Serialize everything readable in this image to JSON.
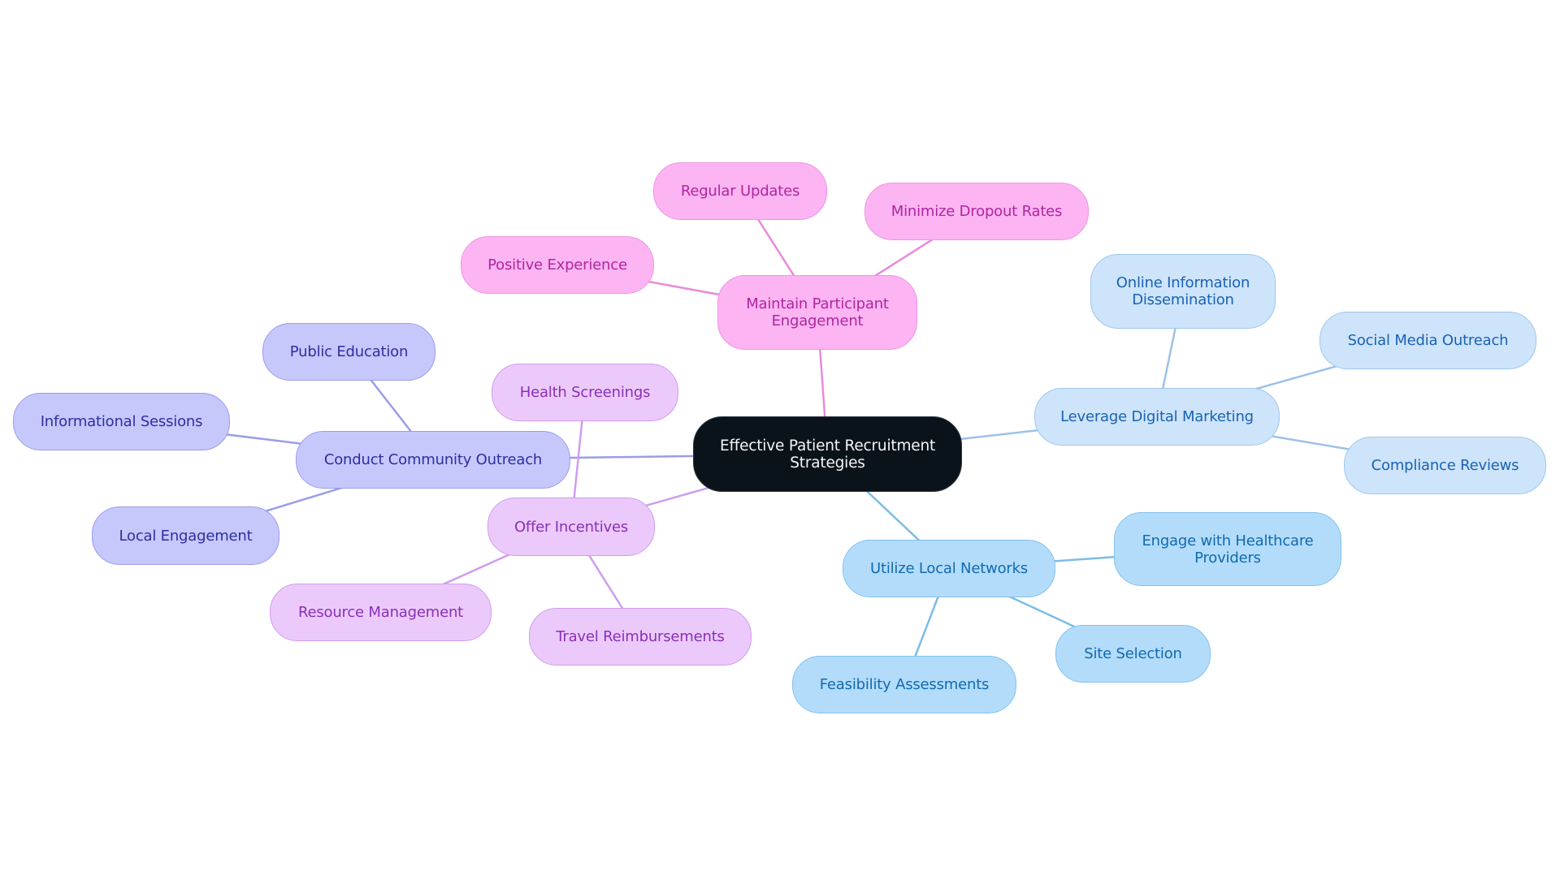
{
  "diagram": {
    "type": "mindmap",
    "root": {
      "id": "root",
      "label": "Effective Patient Recruitment Strategies"
    },
    "branches": [
      {
        "id": "engagement",
        "label": "Maintain Participant Engagement",
        "color_theme": "pink",
        "edge_color": "#e98ad9",
        "children": [
          {
            "id": "regular-updates",
            "label": "Regular Updates"
          },
          {
            "id": "minimize-dropout",
            "label": "Minimize Dropout Rates"
          },
          {
            "id": "positive-experience",
            "label": "Positive Experience"
          }
        ]
      },
      {
        "id": "digital",
        "label": "Leverage Digital Marketing",
        "color_theme": "blue1",
        "edge_color": "#9cc2e8",
        "children": [
          {
            "id": "online-info",
            "label": "Online Information Dissemination"
          },
          {
            "id": "social-media",
            "label": "Social Media Outreach"
          },
          {
            "id": "compliance",
            "label": "Compliance Reviews"
          }
        ]
      },
      {
        "id": "local-networks",
        "label": "Utilize Local Networks",
        "color_theme": "blue2",
        "edge_color": "#7bbde6",
        "children": [
          {
            "id": "healthcare-providers",
            "label": "Engage with Healthcare Providers"
          },
          {
            "id": "site-selection",
            "label": "Site Selection"
          },
          {
            "id": "feasibility",
            "label": "Feasibility Assessments"
          }
        ]
      },
      {
        "id": "community",
        "label": "Conduct Community Outreach",
        "color_theme": "indigo",
        "edge_color": "#9a9ee6",
        "children": [
          {
            "id": "public-education",
            "label": "Public Education"
          },
          {
            "id": "informational-sessions",
            "label": "Informational Sessions"
          },
          {
            "id": "local-engagement",
            "label": "Local Engagement"
          }
        ]
      },
      {
        "id": "incentives",
        "label": "Offer Incentives",
        "color_theme": "violet",
        "edge_color": "#cf9ded",
        "children": [
          {
            "id": "health-screenings",
            "label": "Health Screenings"
          },
          {
            "id": "resource-management",
            "label": "Resource Management"
          },
          {
            "id": "travel-reimbursements",
            "label": "Travel Reimbursements"
          }
        ]
      }
    ]
  }
}
